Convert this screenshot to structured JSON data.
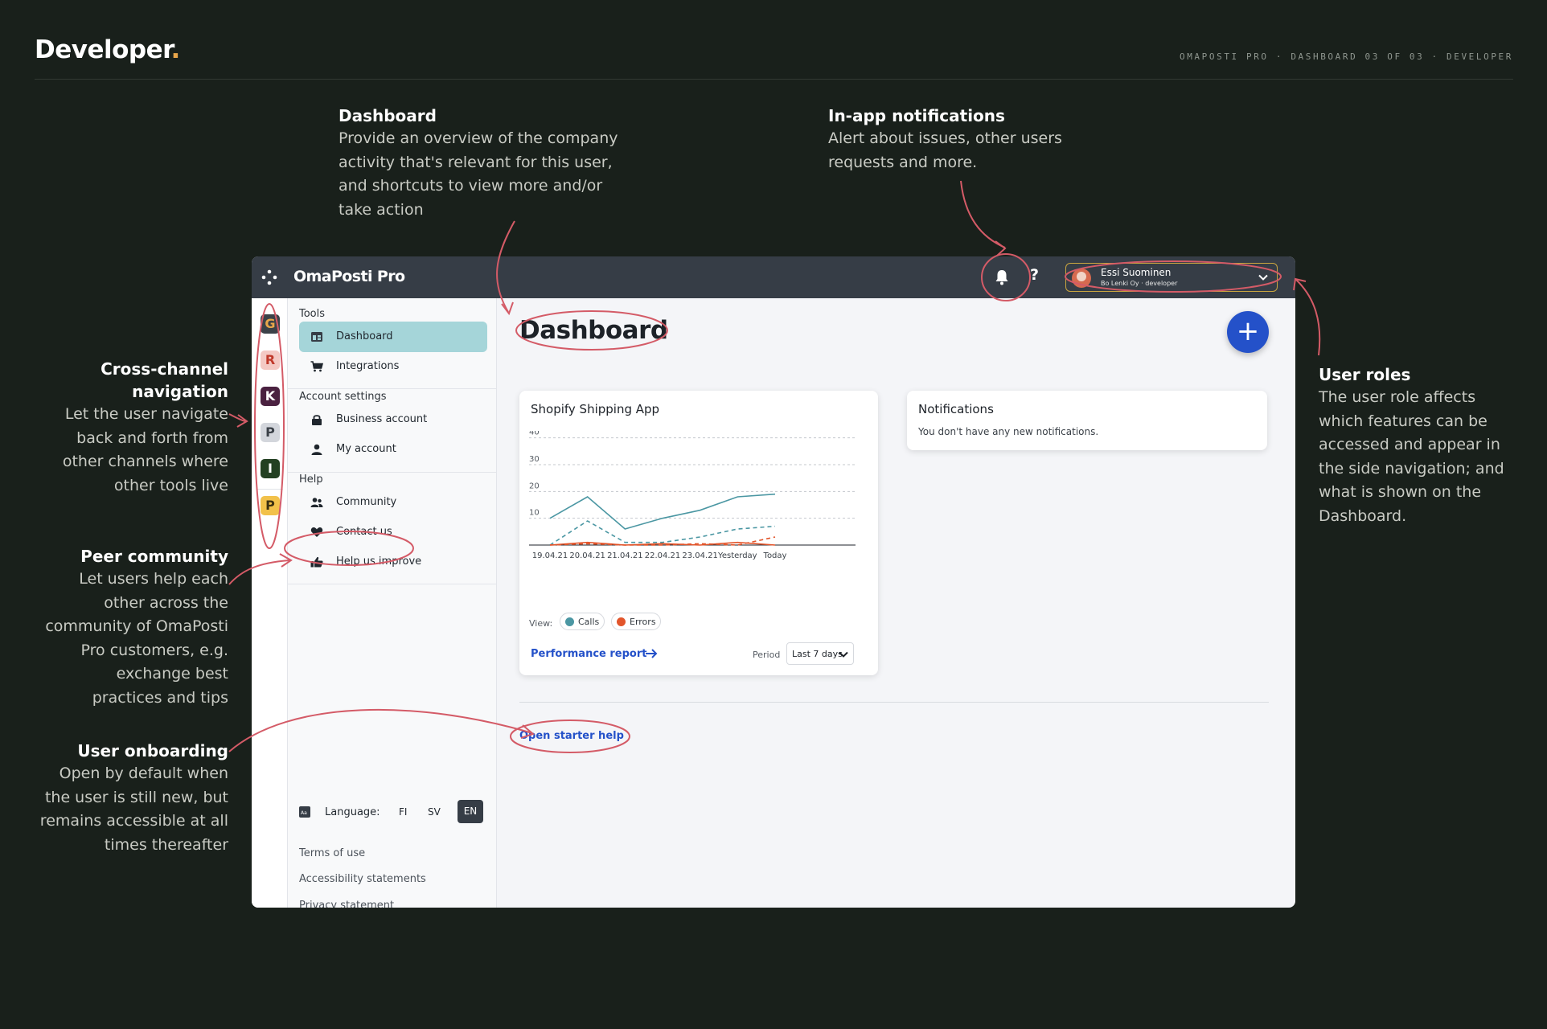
{
  "header": {
    "brand": "Developer",
    "brand_dot": ".",
    "meta": "OMAPOSTI PRO · DASHBOARD 03 OF 03 · DEVELOPER"
  },
  "annotations": {
    "dashboard": {
      "title": "Dashboard",
      "lines": [
        "Provide an overview of the company",
        "activity that's relevant for this user,",
        "and shortcuts to view more and/or",
        "take action"
      ]
    },
    "notifications": {
      "title": "In-app notifications",
      "lines": [
        "Alert about issues, other users",
        "requests and more."
      ]
    },
    "roles": {
      "title": "User roles",
      "lines": [
        "The user role affects",
        "which features can be",
        "accessed and appear in",
        "the side navigation; and",
        "what is shown on the",
        "Dashboard."
      ]
    },
    "cross_channel": {
      "title_lines": [
        "Cross-channel",
        "navigation"
      ],
      "lines": [
        "Let the user navigate",
        "back and forth from",
        "other channels where",
        "other tools live"
      ]
    },
    "peer": {
      "title": "Peer community",
      "lines": [
        "Let users help each",
        "other across the",
        "community of OmaPosti",
        "Pro customers, e.g.",
        "exchange best",
        "practices and tips"
      ]
    },
    "onboarding": {
      "title": "User onboarding",
      "lines": [
        "Open by default when",
        "the user is still new, but",
        "remains accessible at all",
        "times thereafter"
      ]
    }
  },
  "app": {
    "name": "OmaPosti Pro",
    "help_label": "?",
    "user": {
      "name": "Essi Suominen",
      "role": "Bo Lenki Oy · developer"
    },
    "channels": [
      {
        "letter": "G",
        "bg": "#3b4148",
        "fg": "#e8a64a"
      },
      {
        "letter": "R",
        "bg": "#f4c9c4",
        "fg": "#c0392b"
      },
      {
        "letter": "K",
        "bg": "#4a2140",
        "fg": "#ffffff"
      },
      {
        "letter": "P",
        "bg": "#d3d6dc",
        "fg": "#3b4148"
      },
      {
        "letter": "I",
        "bg": "#234022",
        "fg": "#ffffff"
      },
      {
        "letter": "P",
        "bg": "#f2c14a",
        "fg": "#3b2f10"
      }
    ],
    "sidebar": {
      "tools_title": "Tools",
      "tools": [
        {
          "label": "Dashboard",
          "icon": "dashboard-icon"
        },
        {
          "label": "Integrations",
          "icon": "cart-icon"
        }
      ],
      "account_title": "Account settings",
      "account": [
        {
          "label": "Business account",
          "icon": "lock-icon"
        },
        {
          "label": "My account",
          "icon": "person-icon"
        }
      ],
      "help_title": "Help",
      "help": [
        {
          "label": "Community",
          "icon": "people-icon"
        },
        {
          "label": "Contact us",
          "icon": "heart-icon"
        },
        {
          "label": "Help us improve",
          "icon": "thumbs-up-icon"
        }
      ],
      "language": {
        "label": "Language:",
        "options": [
          "FI",
          "SV",
          "EN"
        ],
        "selected": "EN"
      },
      "footer_links": [
        "Terms of use",
        "Accessibility statements",
        "Privacy statement"
      ]
    },
    "main": {
      "title": "Dashboard",
      "add_label": "+",
      "shopify_card": {
        "title": "Shopify Shipping App",
        "view_label": "View:",
        "legend": [
          {
            "label": "Calls",
            "color": "#4b97a3"
          },
          {
            "label": "Errors",
            "color": "#e2552b"
          }
        ],
        "link": "Performance report",
        "period_label": "Period",
        "period_value": "Last 7 days"
      },
      "notifications_card": {
        "title": "Notifications",
        "text": "You don't have any new notifications."
      },
      "starter_help": "Open starter help"
    }
  },
  "chart_data": {
    "type": "line",
    "categories": [
      "19.04.21",
      "20.04.21",
      "21.04.21",
      "22.04.21",
      "23.04.21",
      "Yesterday",
      "Today"
    ],
    "yticks": [
      10,
      20,
      30,
      40
    ],
    "ylim": [
      0,
      42
    ],
    "series": [
      {
        "name": "Calls",
        "style": "solid",
        "color": "#4b97a3",
        "values": [
          10,
          18,
          6,
          10,
          13,
          18,
          19
        ]
      },
      {
        "style": "dashed",
        "color": "#4b97a3",
        "values": [
          0,
          9,
          1,
          1,
          3,
          6,
          7
        ]
      },
      {
        "name": "Errors",
        "style": "solid",
        "color": "#e2552b",
        "values": [
          0,
          1,
          0,
          0.5,
          0,
          1,
          0
        ]
      },
      {
        "style": "dashed",
        "color": "#e2552b",
        "values": [
          0,
          0.5,
          0,
          0,
          0.5,
          0,
          3
        ]
      }
    ]
  },
  "colors": {
    "background": "#19201b",
    "annotation_red": "#d45b67",
    "accent_blue": "#2451c9",
    "active_teal": "#a5d5d9"
  }
}
